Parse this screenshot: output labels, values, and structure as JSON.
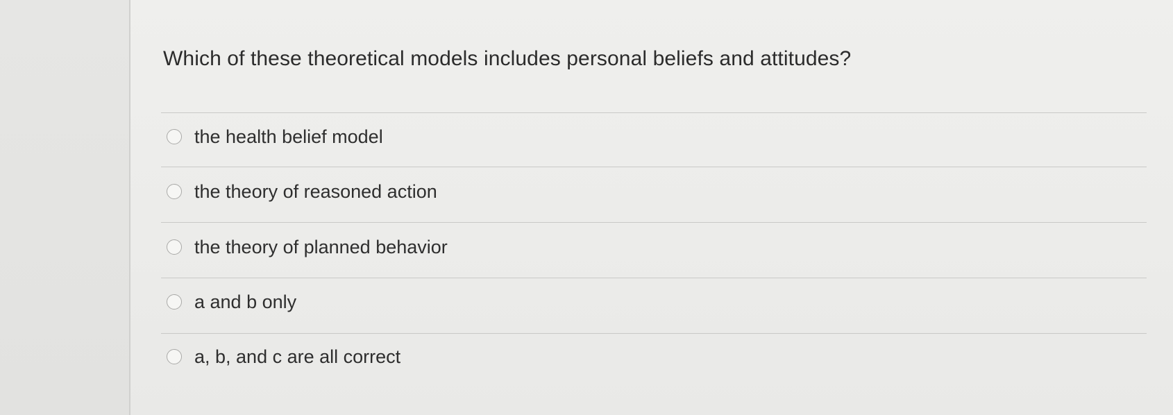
{
  "question": {
    "text": "Which of these theoretical models includes personal beliefs and attitudes?"
  },
  "answers": [
    {
      "label": "the health belief model",
      "selected": false
    },
    {
      "label": "the theory of reasoned action",
      "selected": false
    },
    {
      "label": "the theory of planned behavior",
      "selected": false
    },
    {
      "label": "a and b only",
      "selected": false
    },
    {
      "label": "a, b, and c are all correct",
      "selected": false
    }
  ]
}
